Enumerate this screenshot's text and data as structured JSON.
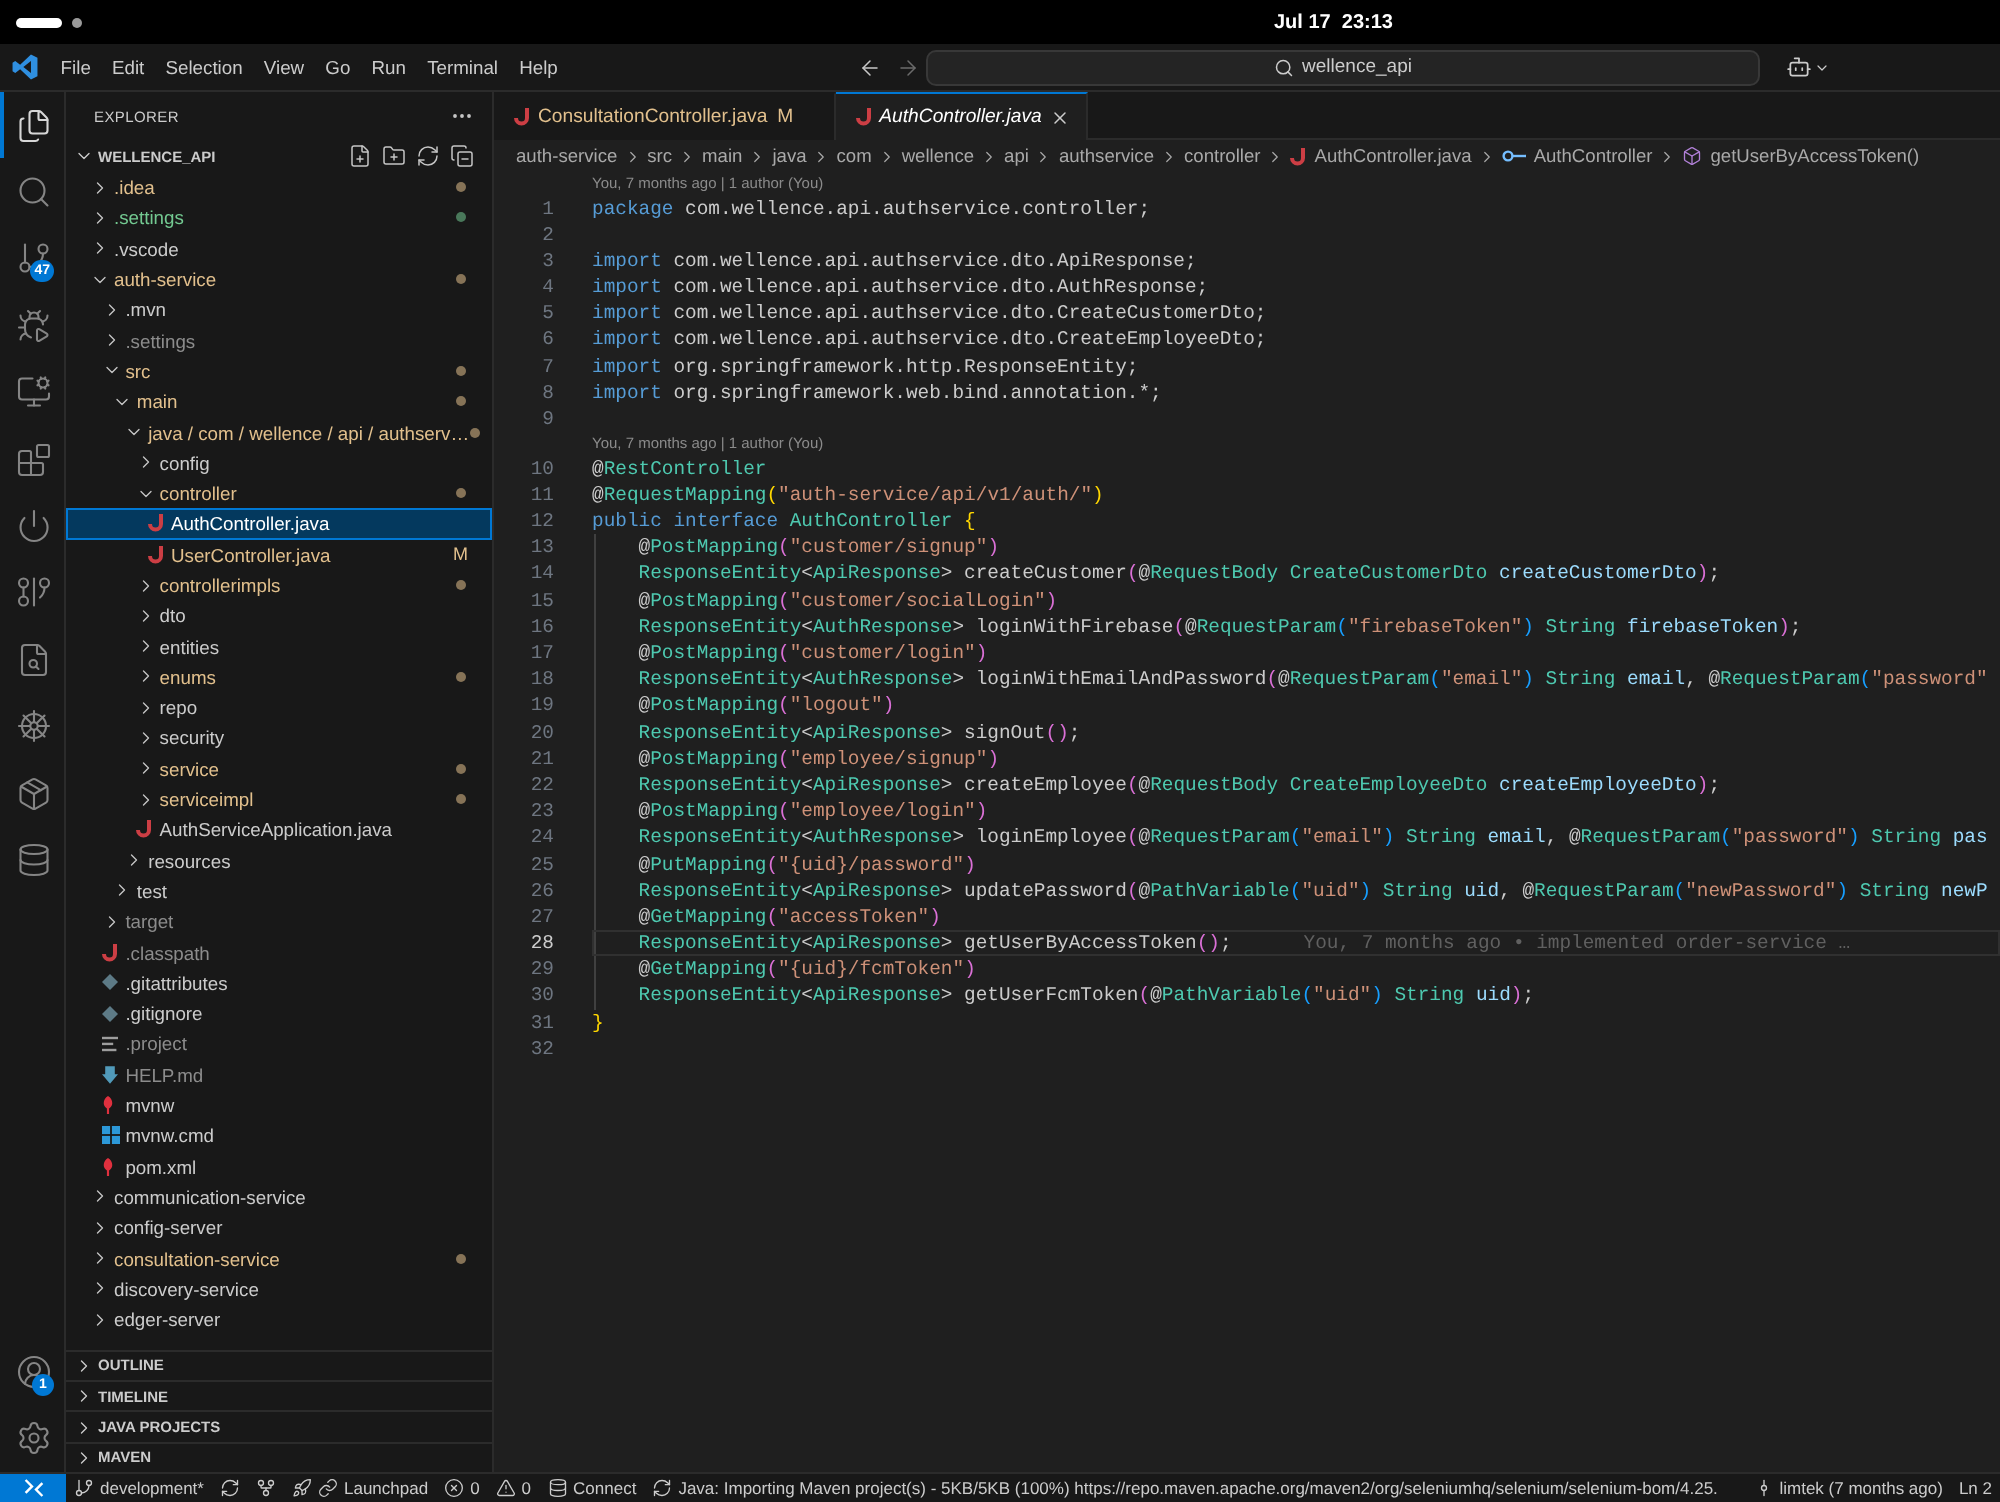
{
  "top_bar": {
    "clock": "Jul 17  23:13"
  },
  "title_bar": {
    "menu": [
      "File",
      "Edit",
      "Selection",
      "View",
      "Go",
      "Run",
      "Terminal",
      "Help"
    ],
    "navigation": [
      {
        "kind": "back",
        "disabled": false
      },
      {
        "kind": "forward",
        "disabled": true
      }
    ],
    "command_center": "wellence_api"
  },
  "activity_bar": {
    "items": [
      {
        "kind": "explorer",
        "selected": true
      },
      {
        "kind": "search",
        "selected": false
      },
      {
        "kind": "source_control",
        "selected": false,
        "badge": "47"
      },
      {
        "kind": "run_debug",
        "selected": false
      },
      {
        "kind": "remote",
        "selected": false
      },
      {
        "kind": "extensions",
        "selected": false
      },
      {
        "kind": "power",
        "selected": false
      },
      {
        "kind": "git_graph",
        "selected": false
      },
      {
        "kind": "lookup",
        "selected": false
      },
      {
        "kind": "helm",
        "selected": false
      },
      {
        "kind": "packages",
        "selected": false
      },
      {
        "kind": "database",
        "selected": false
      }
    ],
    "bottom_items": [
      {
        "kind": "account",
        "badge": "1"
      },
      {
        "kind": "settings"
      }
    ]
  },
  "sidebar": {
    "title": "EXPLORER",
    "root": {
      "label": "WELLENCE_API",
      "expanded": true
    },
    "tree": [
      {
        "name": ".idea",
        "kind": "folder",
        "expanded": false,
        "color": "#e2c08d",
        "dot": true,
        "selected": false
      },
      {
        "name": ".settings",
        "kind": "folder",
        "expanded": false,
        "color": "#73c991",
        "dot": true,
        "selected": false
      },
      {
        "name": ".vscode",
        "kind": "folder",
        "expanded": false,
        "color": "#cccccc",
        "dot": false,
        "selected": false
      },
      {
        "name": "auth-service",
        "kind": "folder",
        "expanded": true,
        "color": "#e2c08d",
        "dot": true,
        "selected": false,
        "children": [
          {
            "name": ".mvn",
            "kind": "folder",
            "expanded": false,
            "color": "#cccccc",
            "dot": false,
            "selected": false
          },
          {
            "name": ".settings",
            "kind": "folder",
            "expanded": false,
            "color": "#8c8c8c",
            "dot": false,
            "selected": false
          },
          {
            "name": "src",
            "kind": "folder",
            "expanded": true,
            "color": "#e2c08d",
            "dot": true,
            "selected": false,
            "children": [
              {
                "name": "main",
                "kind": "folder",
                "expanded": true,
                "color": "#e2c08d",
                "dot": true,
                "selected": false,
                "children": [
                  {
                    "name": "java / com / wellence / api / authserv…",
                    "kind": "folder",
                    "expanded": true,
                    "color": "#e2c08d",
                    "dot": true,
                    "selected": false,
                    "children": [
                      {
                        "name": "config",
                        "kind": "folder",
                        "expanded": false,
                        "color": "#cccccc",
                        "dot": false,
                        "selected": false
                      },
                      {
                        "name": "controller",
                        "kind": "folder",
                        "expanded": true,
                        "color": "#e2c08d",
                        "dot": true,
                        "selected": false,
                        "children": [
                          {
                            "name": "AuthController.java",
                            "kind": "java",
                            "color": "#ffffff",
                            "dot": false,
                            "selected": true
                          },
                          {
                            "name": "UserController.java",
                            "kind": "java",
                            "color": "#e2c08d",
                            "dot": false,
                            "badge": "M",
                            "selected": false
                          }
                        ]
                      },
                      {
                        "name": "controllerimpls",
                        "kind": "folder",
                        "expanded": false,
                        "color": "#e2c08d",
                        "dot": true,
                        "selected": false
                      },
                      {
                        "name": "dto",
                        "kind": "folder",
                        "expanded": false,
                        "color": "#cccccc",
                        "dot": false,
                        "selected": false
                      },
                      {
                        "name": "entities",
                        "kind": "folder",
                        "expanded": false,
                        "color": "#cccccc",
                        "dot": false,
                        "selected": false
                      },
                      {
                        "name": "enums",
                        "kind": "folder",
                        "expanded": false,
                        "color": "#e2c08d",
                        "dot": true,
                        "selected": false
                      },
                      {
                        "name": "repo",
                        "kind": "folder",
                        "expanded": false,
                        "color": "#cccccc",
                        "dot": false,
                        "selected": false
                      },
                      {
                        "name": "security",
                        "kind": "folder",
                        "expanded": false,
                        "color": "#cccccc",
                        "dot": false,
                        "selected": false
                      },
                      {
                        "name": "service",
                        "kind": "folder",
                        "expanded": false,
                        "color": "#e2c08d",
                        "dot": true,
                        "selected": false
                      },
                      {
                        "name": "serviceimpl",
                        "kind": "folder",
                        "expanded": false,
                        "color": "#e2c08d",
                        "dot": true,
                        "selected": false
                      },
                      {
                        "name": "AuthServiceApplication.java",
                        "kind": "java",
                        "color": "#cccccc",
                        "dot": false,
                        "selected": false
                      }
                    ]
                  },
                  {
                    "name": "resources",
                    "kind": "folder",
                    "expanded": false,
                    "color": "#cccccc",
                    "dot": false,
                    "selected": false
                  }
                ]
              },
              {
                "name": "test",
                "kind": "folder",
                "expanded": false,
                "color": "#cccccc",
                "dot": false,
                "selected": false
              }
            ]
          },
          {
            "name": "target",
            "kind": "folder",
            "expanded": false,
            "color": "#8c8c8c",
            "dot": false,
            "selected": false
          },
          {
            "name": ".classpath",
            "kind": "java",
            "color": "#8c8c8c",
            "dot": false,
            "selected": false
          },
          {
            "name": ".gitattributes",
            "kind": "git",
            "color": "#cccccc",
            "dot": false,
            "selected": false
          },
          {
            "name": ".gitignore",
            "kind": "git",
            "color": "#cccccc",
            "dot": false,
            "selected": false
          },
          {
            "name": ".project",
            "kind": "lines",
            "color": "#8c8c8c",
            "dot": false,
            "selected": false
          },
          {
            "name": "HELP.md",
            "kind": "markdown",
            "color": "#8c8c8c",
            "dot": false,
            "selected": false
          },
          {
            "name": "mvnw",
            "kind": "maven",
            "color": "#cccccc",
            "dot": false,
            "selected": false
          },
          {
            "name": "mvnw.cmd",
            "kind": "windows",
            "color": "#cccccc",
            "dot": false,
            "selected": false
          },
          {
            "name": "pom.xml",
            "kind": "maven",
            "color": "#cccccc",
            "dot": false,
            "selected": false
          }
        ]
      },
      {
        "name": "communication-service",
        "kind": "folder",
        "expanded": false,
        "color": "#cccccc",
        "dot": false,
        "selected": false
      },
      {
        "name": "config-server",
        "kind": "folder",
        "expanded": false,
        "color": "#cccccc",
        "dot": false,
        "selected": false
      },
      {
        "name": "consultation-service",
        "kind": "folder",
        "expanded": false,
        "color": "#e2c08d",
        "dot": true,
        "selected": false
      },
      {
        "name": "discovery-service",
        "kind": "folder",
        "expanded": false,
        "color": "#cccccc",
        "dot": false,
        "selected": false
      },
      {
        "name": "edger-server",
        "kind": "folder",
        "expanded": false,
        "color": "#cccccc",
        "dot": false,
        "selected": false
      }
    ],
    "panels": [
      {
        "label": "OUTLINE",
        "expanded": false
      },
      {
        "label": "TIMELINE",
        "expanded": false
      },
      {
        "label": "JAVA PROJECTS",
        "expanded": false
      },
      {
        "label": "MAVEN",
        "expanded": false
      }
    ]
  },
  "editor": {
    "tabs": [
      {
        "label": "ConsultationController.java",
        "kind": "java",
        "modified": true,
        "badge": "M",
        "selected": false,
        "preview": false
      },
      {
        "label": "AuthController.java",
        "kind": "java",
        "modified": false,
        "selected": true,
        "preview": true
      }
    ],
    "breadcrumbs": [
      {
        "kind": "folder",
        "label": "auth-service"
      },
      {
        "kind": "folder",
        "label": "src"
      },
      {
        "kind": "folder",
        "label": "main"
      },
      {
        "kind": "folder",
        "label": "java"
      },
      {
        "kind": "folder",
        "label": "com"
      },
      {
        "kind": "folder",
        "label": "wellence"
      },
      {
        "kind": "folder",
        "label": "api"
      },
      {
        "kind": "folder",
        "label": "authservice"
      },
      {
        "kind": "folder",
        "label": "controller"
      },
      {
        "kind": "java",
        "label": "AuthController.java"
      },
      {
        "kind": "interface",
        "label": "AuthController"
      },
      {
        "kind": "method",
        "label": "getUserByAccessToken()"
      }
    ],
    "code": {
      "lines": [
        {
          "number": "1",
          "codelens": "You, 7 months ago | 1 author (You)",
          "selected": false,
          "tokens": [
            {
              "kind": "kw",
              "text": "package"
            },
            {
              "kind": "plain",
              "text": " com.wellence.api.authservice.controller;"
            }
          ]
        },
        {
          "number": "2",
          "selected": false
        },
        {
          "number": "3",
          "selected": false,
          "tokens": [
            {
              "kind": "kw",
              "text": "import"
            },
            {
              "kind": "plain",
              "text": " com.wellence.api.authservice.dto.ApiResponse;"
            }
          ]
        },
        {
          "number": "4",
          "selected": false,
          "tokens": [
            {
              "kind": "kw",
              "text": "import"
            },
            {
              "kind": "plain",
              "text": " com.wellence.api.authservice.dto.AuthResponse;"
            }
          ]
        },
        {
          "number": "5",
          "selected": false,
          "tokens": [
            {
              "kind": "kw",
              "text": "import"
            },
            {
              "kind": "plain",
              "text": " com.wellence.api.authservice.dto.CreateCustomerDto;"
            }
          ]
        },
        {
          "number": "6",
          "selected": false,
          "tokens": [
            {
              "kind": "kw",
              "text": "import"
            },
            {
              "kind": "plain",
              "text": " com.wellence.api.authservice.dto.CreateEmployeeDto;"
            }
          ]
        },
        {
          "number": "7",
          "selected": false,
          "tokens": [
            {
              "kind": "kw",
              "text": "import"
            },
            {
              "kind": "plain",
              "text": " org.springframework.http.ResponseEntity;"
            }
          ]
        },
        {
          "number": "8",
          "selected": false,
          "tokens": [
            {
              "kind": "kw",
              "text": "import"
            },
            {
              "kind": "plain",
              "text": " org.springframework.web.bind.annotation.*;"
            }
          ]
        },
        {
          "number": "9",
          "selected": false
        },
        {
          "number": "10",
          "codelens": "You, 7 months ago | 1 author (You)",
          "selected": false,
          "tokens": [
            {
              "kind": "plain",
              "text": "@"
            },
            {
              "kind": "type",
              "text": "RestController"
            }
          ]
        },
        {
          "number": "11",
          "selected": false,
          "tokens": [
            {
              "kind": "plain",
              "text": "@"
            },
            {
              "kind": "type",
              "text": "RequestMapping"
            },
            {
              "kind": "b1",
              "text": "("
            },
            {
              "kind": "str",
              "text": "\"auth-service/api/v1/auth/\""
            },
            {
              "kind": "b1",
              "text": ")"
            }
          ]
        },
        {
          "number": "12",
          "selected": false,
          "tokens": [
            {
              "kind": "kw",
              "text": "public"
            },
            {
              "kind": "kw",
              "text": " interface"
            },
            {
              "kind": "type",
              "text": " AuthController"
            },
            {
              "kind": "b1",
              "text": " {"
            }
          ],
          "children": [
            {
              "number": "13",
              "selected": false,
              "tokens": [
                {
                  "kind": "plain",
                  "text": "@"
                },
                {
                  "kind": "type",
                  "text": "PostMapping"
                },
                {
                  "kind": "b2",
                  "text": "("
                },
                {
                  "kind": "str",
                  "text": "\"customer/signup\""
                },
                {
                  "kind": "b2",
                  "text": ")"
                }
              ]
            },
            {
              "number": "14",
              "selected": false,
              "tokens": [
                {
                  "kind": "type",
                  "text": "ResponseEntity"
                },
                {
                  "kind": "plain",
                  "text": "<"
                },
                {
                  "kind": "type",
                  "text": "ApiResponse"
                },
                {
                  "kind": "plain",
                  "text": "> createCustomer"
                },
                {
                  "kind": "b2",
                  "text": "("
                },
                {
                  "kind": "plain",
                  "text": "@"
                },
                {
                  "kind": "type",
                  "text": "RequestBody"
                },
                {
                  "kind": "type",
                  "text": " CreateCustomerDto"
                },
                {
                  "kind": "param",
                  "text": " createCustomerDto"
                },
                {
                  "kind": "b2",
                  "text": ")"
                },
                {
                  "kind": "plain",
                  "text": ";"
                }
              ]
            },
            {
              "number": "15",
              "selected": false,
              "tokens": [
                {
                  "kind": "plain",
                  "text": "@"
                },
                {
                  "kind": "type",
                  "text": "PostMapping"
                },
                {
                  "kind": "b2",
                  "text": "("
                },
                {
                  "kind": "str",
                  "text": "\"customer/socialLogin\""
                },
                {
                  "kind": "b2",
                  "text": ")"
                }
              ]
            },
            {
              "number": "16",
              "selected": false,
              "tokens": [
                {
                  "kind": "type",
                  "text": "ResponseEntity"
                },
                {
                  "kind": "plain",
                  "text": "<"
                },
                {
                  "kind": "type",
                  "text": "AuthResponse"
                },
                {
                  "kind": "plain",
                  "text": "> loginWithFirebase"
                },
                {
                  "kind": "b2",
                  "text": "("
                },
                {
                  "kind": "plain",
                  "text": "@"
                },
                {
                  "kind": "type",
                  "text": "RequestParam"
                },
                {
                  "kind": "b3",
                  "text": "("
                },
                {
                  "kind": "str",
                  "text": "\"firebaseToken\""
                },
                {
                  "kind": "b3",
                  "text": ")"
                },
                {
                  "kind": "type",
                  "text": " String"
                },
                {
                  "kind": "param",
                  "text": " firebaseToken"
                },
                {
                  "kind": "b2",
                  "text": ")"
                },
                {
                  "kind": "plain",
                  "text": ";"
                }
              ]
            },
            {
              "number": "17",
              "selected": false,
              "tokens": [
                {
                  "kind": "plain",
                  "text": "@"
                },
                {
                  "kind": "type",
                  "text": "PostMapping"
                },
                {
                  "kind": "b2",
                  "text": "("
                },
                {
                  "kind": "str",
                  "text": "\"customer/login\""
                },
                {
                  "kind": "b2",
                  "text": ")"
                }
              ]
            },
            {
              "number": "18",
              "selected": false,
              "tokens": [
                {
                  "kind": "type",
                  "text": "ResponseEntity"
                },
                {
                  "kind": "plain",
                  "text": "<"
                },
                {
                  "kind": "type",
                  "text": "AuthResponse"
                },
                {
                  "kind": "plain",
                  "text": "> loginWithEmailAndPassword"
                },
                {
                  "kind": "b2",
                  "text": "("
                },
                {
                  "kind": "plain",
                  "text": "@"
                },
                {
                  "kind": "type",
                  "text": "RequestParam"
                },
                {
                  "kind": "b3",
                  "text": "("
                },
                {
                  "kind": "str",
                  "text": "\"email\""
                },
                {
                  "kind": "b3",
                  "text": ")"
                },
                {
                  "kind": "type",
                  "text": " String"
                },
                {
                  "kind": "param",
                  "text": " email"
                },
                {
                  "kind": "plain",
                  "text": ", @"
                },
                {
                  "kind": "type",
                  "text": "RequestParam"
                },
                {
                  "kind": "b3",
                  "text": "("
                },
                {
                  "kind": "str",
                  "text": "\"password\""
                }
              ]
            },
            {
              "number": "19",
              "selected": false,
              "tokens": [
                {
                  "kind": "plain",
                  "text": "@"
                },
                {
                  "kind": "type",
                  "text": "PostMapping"
                },
                {
                  "kind": "b2",
                  "text": "("
                },
                {
                  "kind": "str",
                  "text": "\"logout\""
                },
                {
                  "kind": "b2",
                  "text": ")"
                }
              ]
            },
            {
              "number": "20",
              "selected": false,
              "tokens": [
                {
                  "kind": "type",
                  "text": "ResponseEntity"
                },
                {
                  "kind": "plain",
                  "text": "<"
                },
                {
                  "kind": "type",
                  "text": "ApiResponse"
                },
                {
                  "kind": "plain",
                  "text": "> signOut"
                },
                {
                  "kind": "b2",
                  "text": "()"
                },
                {
                  "kind": "plain",
                  "text": ";"
                }
              ]
            },
            {
              "number": "21",
              "selected": false,
              "tokens": [
                {
                  "kind": "plain",
                  "text": "@"
                },
                {
                  "kind": "type",
                  "text": "PostMapping"
                },
                {
                  "kind": "b2",
                  "text": "("
                },
                {
                  "kind": "str",
                  "text": "\"employee/signup\""
                },
                {
                  "kind": "b2",
                  "text": ")"
                }
              ]
            },
            {
              "number": "22",
              "selected": false,
              "tokens": [
                {
                  "kind": "type",
                  "text": "ResponseEntity"
                },
                {
                  "kind": "plain",
                  "text": "<"
                },
                {
                  "kind": "type",
                  "text": "ApiResponse"
                },
                {
                  "kind": "plain",
                  "text": "> createEmployee"
                },
                {
                  "kind": "b2",
                  "text": "("
                },
                {
                  "kind": "plain",
                  "text": "@"
                },
                {
                  "kind": "type",
                  "text": "RequestBody"
                },
                {
                  "kind": "type",
                  "text": " CreateEmployeeDto"
                },
                {
                  "kind": "param",
                  "text": " createEmployeeDto"
                },
                {
                  "kind": "b2",
                  "text": ")"
                },
                {
                  "kind": "plain",
                  "text": ";"
                }
              ]
            },
            {
              "number": "23",
              "selected": false,
              "tokens": [
                {
                  "kind": "plain",
                  "text": "@"
                },
                {
                  "kind": "type",
                  "text": "PostMapping"
                },
                {
                  "kind": "b2",
                  "text": "("
                },
                {
                  "kind": "str",
                  "text": "\"employee/login\""
                },
                {
                  "kind": "b2",
                  "text": ")"
                }
              ]
            },
            {
              "number": "24",
              "selected": false,
              "tokens": [
                {
                  "kind": "type",
                  "text": "ResponseEntity"
                },
                {
                  "kind": "plain",
                  "text": "<"
                },
                {
                  "kind": "type",
                  "text": "AuthResponse"
                },
                {
                  "kind": "plain",
                  "text": "> loginEmployee"
                },
                {
                  "kind": "b2",
                  "text": "("
                },
                {
                  "kind": "plain",
                  "text": "@"
                },
                {
                  "kind": "type",
                  "text": "RequestParam"
                },
                {
                  "kind": "b3",
                  "text": "("
                },
                {
                  "kind": "str",
                  "text": "\"email\""
                },
                {
                  "kind": "b3",
                  "text": ")"
                },
                {
                  "kind": "type",
                  "text": " String"
                },
                {
                  "kind": "param",
                  "text": " email"
                },
                {
                  "kind": "plain",
                  "text": ", @"
                },
                {
                  "kind": "type",
                  "text": "RequestParam"
                },
                {
                  "kind": "b3",
                  "text": "("
                },
                {
                  "kind": "str",
                  "text": "\"password\""
                },
                {
                  "kind": "b3",
                  "text": ")"
                },
                {
                  "kind": "type",
                  "text": " String"
                },
                {
                  "kind": "param",
                  "text": " pas"
                }
              ]
            },
            {
              "number": "25",
              "selected": false,
              "tokens": [
                {
                  "kind": "plain",
                  "text": "@"
                },
                {
                  "kind": "type",
                  "text": "PutMapping"
                },
                {
                  "kind": "b2",
                  "text": "("
                },
                {
                  "kind": "str",
                  "text": "\"{uid}/password\""
                },
                {
                  "kind": "b2",
                  "text": ")"
                }
              ]
            },
            {
              "number": "26",
              "selected": false,
              "tokens": [
                {
                  "kind": "type",
                  "text": "ResponseEntity"
                },
                {
                  "kind": "plain",
                  "text": "<"
                },
                {
                  "kind": "type",
                  "text": "ApiResponse"
                },
                {
                  "kind": "plain",
                  "text": "> updatePassword"
                },
                {
                  "kind": "b2",
                  "text": "("
                },
                {
                  "kind": "plain",
                  "text": "@"
                },
                {
                  "kind": "type",
                  "text": "PathVariable"
                },
                {
                  "kind": "b3",
                  "text": "("
                },
                {
                  "kind": "str",
                  "text": "\"uid\""
                },
                {
                  "kind": "b3",
                  "text": ")"
                },
                {
                  "kind": "type",
                  "text": " String"
                },
                {
                  "kind": "param",
                  "text": " uid"
                },
                {
                  "kind": "plain",
                  "text": ", @"
                },
                {
                  "kind": "type",
                  "text": "RequestParam"
                },
                {
                  "kind": "b3",
                  "text": "("
                },
                {
                  "kind": "str",
                  "text": "\"newPassword\""
                },
                {
                  "kind": "b3",
                  "text": ")"
                },
                {
                  "kind": "type",
                  "text": " String"
                },
                {
                  "kind": "param",
                  "text": " newP"
                }
              ]
            },
            {
              "number": "27",
              "selected": false,
              "tokens": [
                {
                  "kind": "plain",
                  "text": "@"
                },
                {
                  "kind": "type",
                  "text": "GetMapping"
                },
                {
                  "kind": "b2",
                  "text": "("
                },
                {
                  "kind": "str",
                  "text": "\"accessToken\""
                },
                {
                  "kind": "b2",
                  "text": ")"
                }
              ]
            },
            {
              "number": "28",
              "selected": true,
              "blame": "You, 7 months ago • implemented order-service …",
              "tokens": [
                {
                  "kind": "type",
                  "text": "ResponseEntity"
                },
                {
                  "kind": "plain",
                  "text": "<"
                },
                {
                  "kind": "type",
                  "text": "ApiResponse"
                },
                {
                  "kind": "plain",
                  "text": "> getUserByAccessToken"
                },
                {
                  "kind": "b2",
                  "text": "()"
                },
                {
                  "kind": "plain",
                  "text": ";"
                }
              ]
            },
            {
              "number": "29",
              "selected": false,
              "tokens": [
                {
                  "kind": "plain",
                  "text": "@"
                },
                {
                  "kind": "type",
                  "text": "GetMapping"
                },
                {
                  "kind": "b2",
                  "text": "("
                },
                {
                  "kind": "str",
                  "text": "\"{uid}/fcmToken\""
                },
                {
                  "kind": "b2",
                  "text": ")"
                }
              ]
            },
            {
              "number": "30",
              "selected": false,
              "tokens": [
                {
                  "kind": "type",
                  "text": "ResponseEntity"
                },
                {
                  "kind": "plain",
                  "text": "<"
                },
                {
                  "kind": "type",
                  "text": "ApiResponse"
                },
                {
                  "kind": "plain",
                  "text": "> getUserFcmToken"
                },
                {
                  "kind": "b2",
                  "text": "("
                },
                {
                  "kind": "plain",
                  "text": "@"
                },
                {
                  "kind": "type",
                  "text": "PathVariable"
                },
                {
                  "kind": "b3",
                  "text": "("
                },
                {
                  "kind": "str",
                  "text": "\"uid\""
                },
                {
                  "kind": "b3",
                  "text": ")"
                },
                {
                  "kind": "type",
                  "text": " String"
                },
                {
                  "kind": "param",
                  "text": " uid"
                },
                {
                  "kind": "b2",
                  "text": ")"
                },
                {
                  "kind": "plain",
                  "text": ";"
                }
              ]
            }
          ]
        },
        {
          "number": "31",
          "selected": false,
          "tokens": [
            {
              "kind": "b1",
              "text": "}"
            }
          ]
        },
        {
          "number": "32",
          "selected": false
        }
      ]
    }
  },
  "status_bar": {
    "items": [
      {
        "kind": "remote"
      },
      {
        "kind": "branch",
        "text": "development*"
      },
      {
        "kind": "sync"
      },
      {
        "kind": "graph"
      },
      {
        "kind": "launchpad",
        "text": "Launchpad"
      },
      {
        "kind": "errors",
        "text": "0"
      },
      {
        "kind": "warnings",
        "text": "0"
      },
      {
        "kind": "connect",
        "text": "Connect"
      },
      {
        "kind": "progress",
        "text": "Java: Importing Maven project(s) - 5KB/5KB (100%) https://repo.maven.apache.org/maven2/org/seleniumhq/selenium/selenium-bom/4.25."
      },
      {
        "kind": "blame",
        "text": "limtek (7 months ago)"
      },
      {
        "kind": "position",
        "text": "Ln 2"
      }
    ]
  }
}
